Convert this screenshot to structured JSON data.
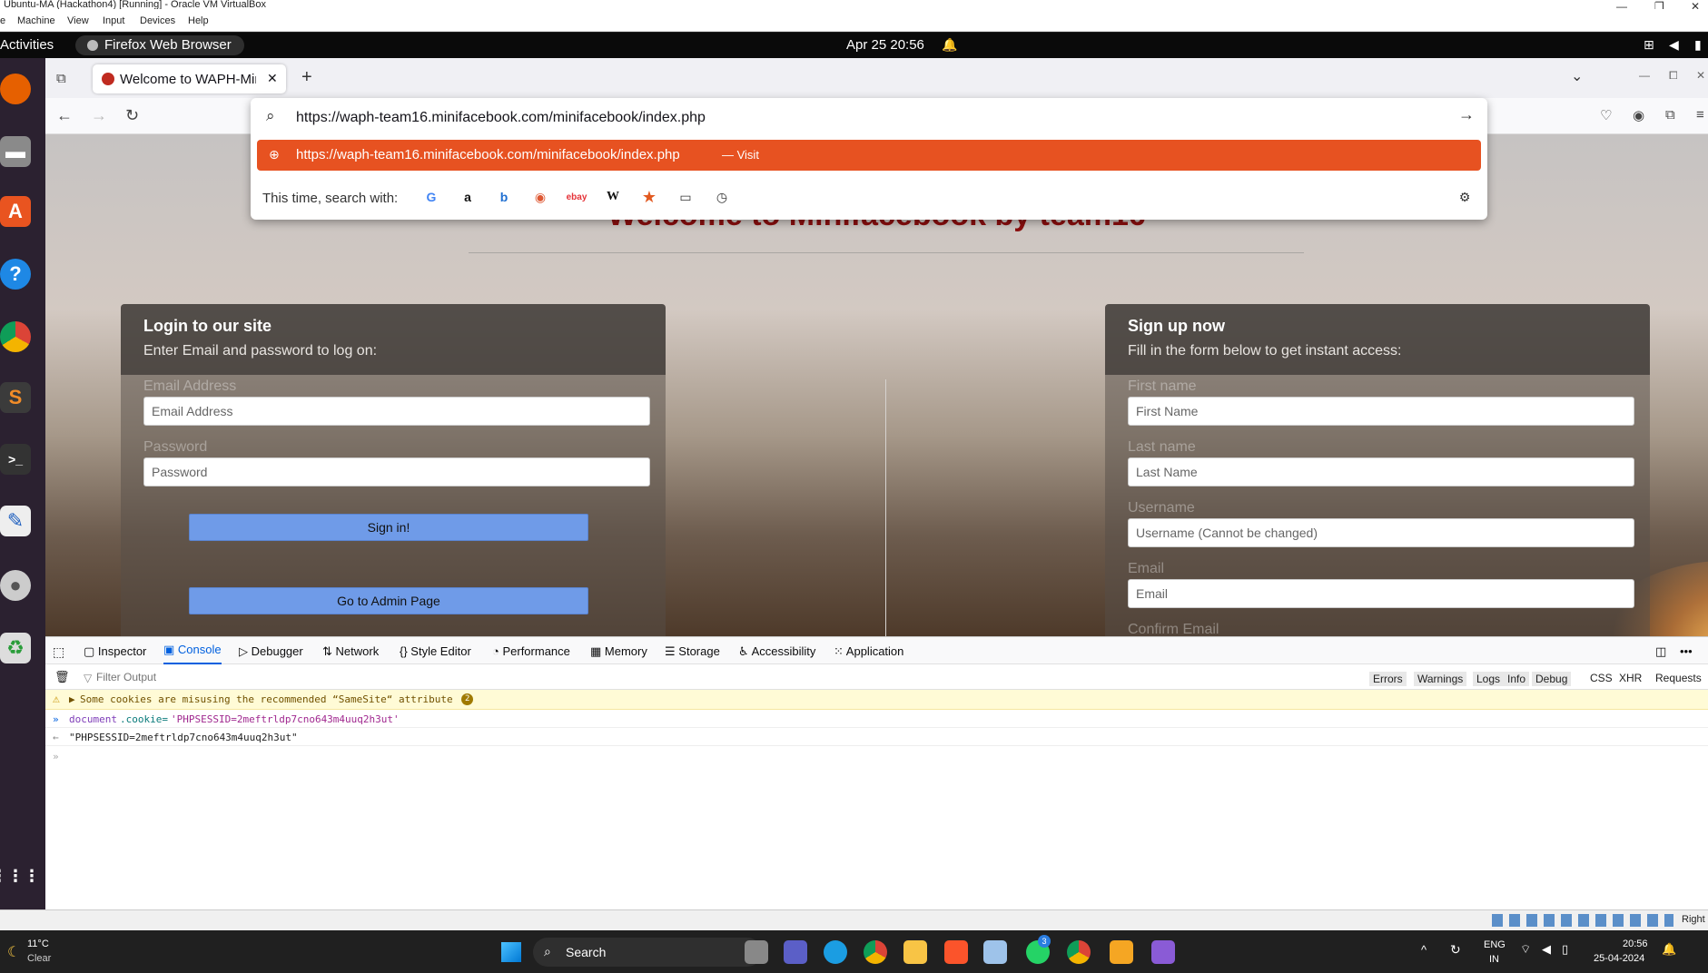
{
  "vbox": {
    "title": "Ubuntu-MA (Hackathon4) [Running] - Oracle VM VirtualBox",
    "menu": [
      "e",
      "Machine",
      "View",
      "Input",
      "Devices",
      "Help"
    ],
    "status_right": "Right"
  },
  "gnome": {
    "activities": "Activities",
    "app_name": "Firefox Web Browser",
    "clock": "Apr 25  20:56"
  },
  "browser": {
    "tab_title": "Welcome to WAPH-MiniF",
    "url": "https://waph-team16.minifacebook.com/minifacebook/index.php",
    "suggestion_url": "https://waph-team16.minifacebook.com/minifacebook/index.php",
    "suggestion_action": "— Visit",
    "search_with_label": "This time, search with:",
    "engines": [
      "google-icon",
      "amazon-icon",
      "bing-icon",
      "duckduckgo-icon",
      "ebay-icon",
      "wikipedia-icon",
      "bookmarks-icon",
      "tabs-icon",
      "history-icon"
    ]
  },
  "page": {
    "welcome": "Welcome to Minifacebook by team16",
    "login": {
      "title": "Login to our site",
      "subtitle": "Enter Email and password to log on:",
      "email_label": "Email Address",
      "email_placeholder": "Email Address",
      "password_label": "Password",
      "password_placeholder": "Password",
      "sign_in": "Sign in!",
      "admin": "Go to Admin Page"
    },
    "signup": {
      "title": "Sign up now",
      "subtitle": "Fill in the form below to get instant access:",
      "first_label": "First name",
      "first_placeholder": "First Name",
      "last_label": "Last name",
      "last_placeholder": "Last Name",
      "username_label": "Username",
      "username_placeholder": "Username (Cannot be changed)",
      "email_label": "Email",
      "email_placeholder": "Email",
      "confirm_label": "Confirm Email"
    }
  },
  "devtools": {
    "tabs": [
      "Inspector",
      "Console",
      "Debugger",
      "Network",
      "Style Editor",
      "Performance",
      "Memory",
      "Storage",
      "Accessibility",
      "Application"
    ],
    "active_tab": "Console",
    "filter_placeholder": "Filter Output",
    "filters": [
      "Errors",
      "Warnings",
      "Logs",
      "Info",
      "Debug",
      "CSS",
      "XHR",
      "Requests"
    ],
    "warning": "Some cookies are misusing the recommended “SameSite“ attribute",
    "warning_count": "2",
    "input_line_keyword": "document",
    "input_line_prop": ".cookie=",
    "input_line_value": "'PHPSESSID=2meftrldp7cno643m4uuq2h3ut'",
    "output_line": "\"PHPSESSID=2meftrldp7cno643m4uuq2h3ut\""
  },
  "taskbar": {
    "weather_temp": "11°C",
    "weather_desc": "Clear",
    "search": "Search",
    "lang1": "ENG",
    "lang2": "IN",
    "time": "20:56",
    "date": "25-04-2024",
    "whatsapp_badge": "3"
  },
  "colors": {
    "accent_orange": "#e75221",
    "welcome_red": "#8b0e0e",
    "button_blue": "#6f9be8"
  }
}
